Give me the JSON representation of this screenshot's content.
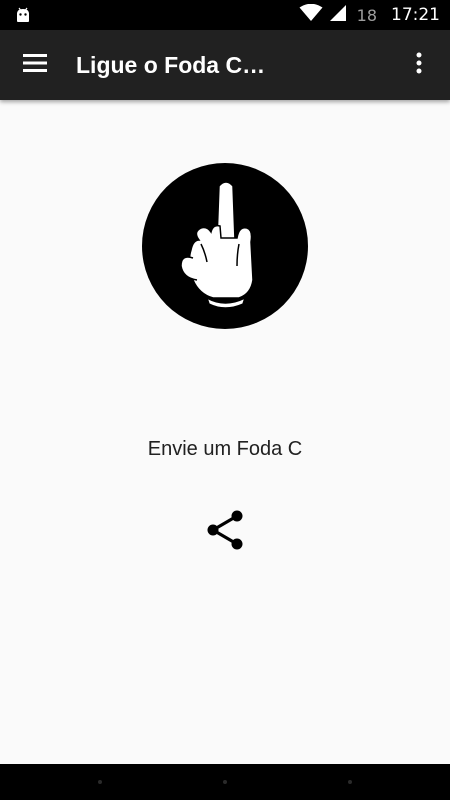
{
  "status_bar": {
    "android_icon": "android-robot-icon",
    "wifi_icon": "wifi-icon",
    "signal_icon": "cell-signal-icon",
    "battery_level": "18",
    "time": "17:21"
  },
  "app_bar": {
    "menu_icon": "hamburger-menu-icon",
    "title": "Ligue o Foda C…",
    "overflow_icon": "more-vert-icon",
    "background": "#212121"
  },
  "main": {
    "logo_icon": "middle-finger-logo-icon",
    "message": "Envie um Foda C",
    "share_icon": "share-icon"
  },
  "nav_bar": {
    "buttons": [
      "back-dot",
      "home-dot",
      "recents-dot"
    ]
  }
}
